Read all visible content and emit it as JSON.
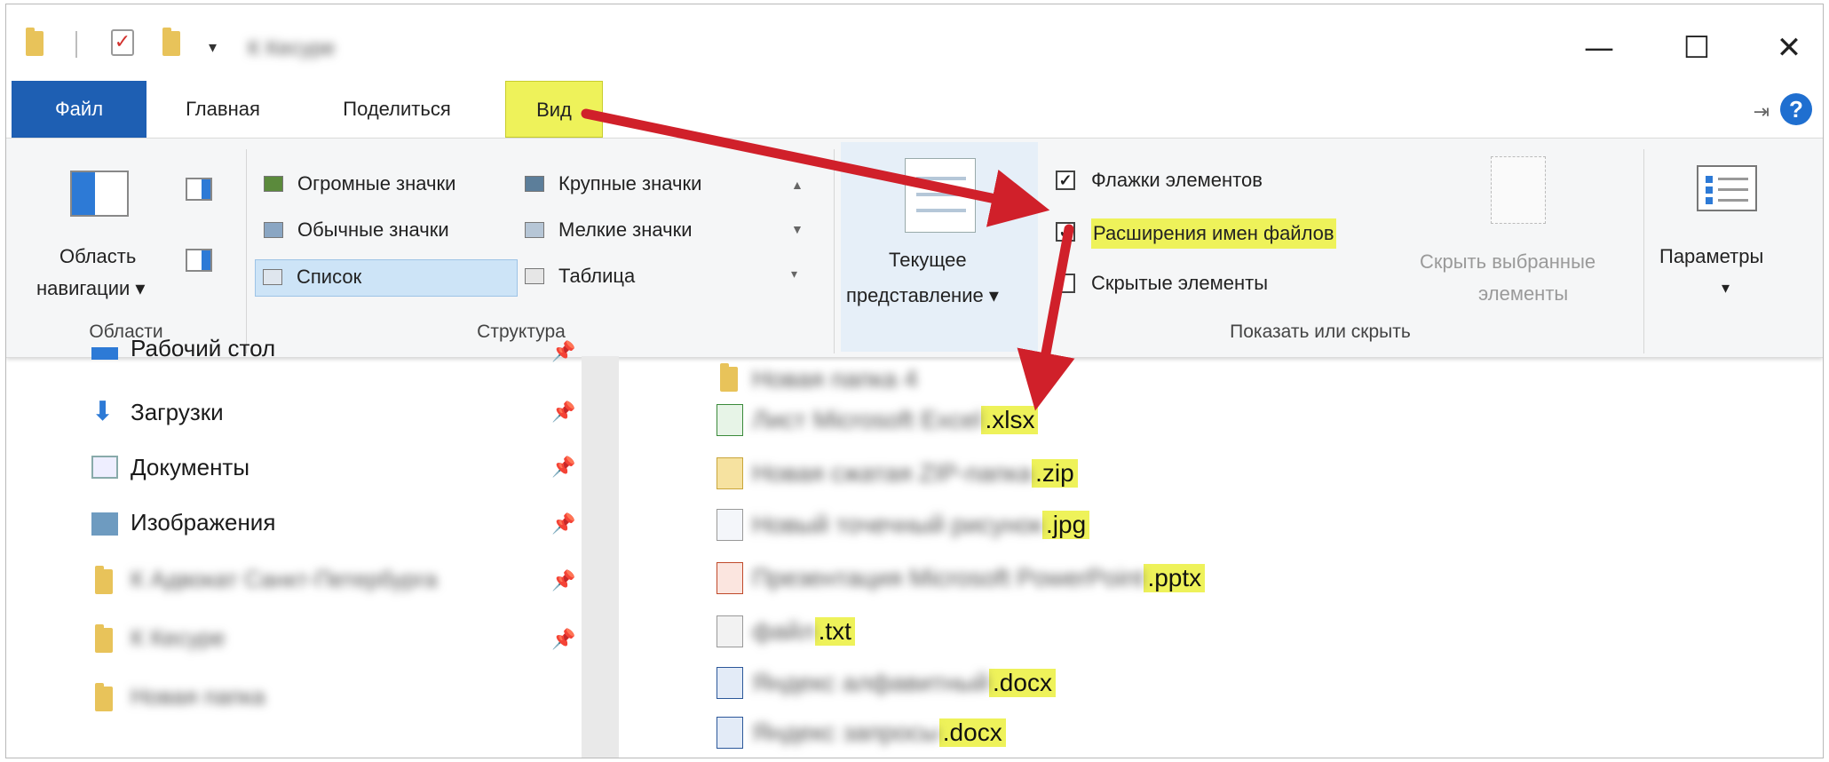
{
  "titlebar": {
    "title": "К Кесуре",
    "controls": {
      "minimize": "—",
      "maximize": "☐",
      "close": "✕"
    },
    "qa_dropdown": "▾"
  },
  "tabs": [
    {
      "label": "Файл"
    },
    {
      "label": "Главная"
    },
    {
      "label": "Поделиться"
    },
    {
      "label": "Вид"
    }
  ],
  "ribbon": {
    "areas": {
      "nav_pane_label_line1": "Область",
      "nav_pane_label_line2": "навигации ▾",
      "group": "Области"
    },
    "structure": {
      "items": [
        {
          "label": "Огромные значки"
        },
        {
          "label": "Крупные значки"
        },
        {
          "label": "Обычные значки"
        },
        {
          "label": "Мелкие значки"
        },
        {
          "label": "Список",
          "selected": true
        },
        {
          "label": "Таблица"
        }
      ],
      "group": "Структура"
    },
    "current_view": {
      "line1": "Текущее",
      "line2": "представление ▾"
    },
    "show_hide": {
      "checkboxes": [
        {
          "label": "Флажки элементов",
          "checked": true
        },
        {
          "label": "Расширения имен файлов",
          "checked": true
        },
        {
          "label": "Скрытые элементы",
          "checked": false
        }
      ],
      "hide_selected_line1": "Скрыть выбранные",
      "hide_selected_line2": "элементы",
      "group": "Показать или скрыть"
    },
    "params": {
      "label": "Параметры",
      "caret": "▾"
    }
  },
  "nav_items": [
    {
      "label": "Рабочий стол",
      "pinned": true,
      "icon": "desktop-icon"
    },
    {
      "label": "Загрузки",
      "pinned": true,
      "icon": "download-icon"
    },
    {
      "label": "Документы",
      "pinned": true,
      "icon": "documents-icon"
    },
    {
      "label": "Изображения",
      "pinned": true,
      "icon": "images-icon"
    },
    {
      "label": "К Адвокат Санкт-Петербурга",
      "pinned": true,
      "icon": "folder-icon",
      "blurred": true
    },
    {
      "label": "К Кесуре",
      "pinned": true,
      "icon": "folder-icon",
      "blurred": true
    },
    {
      "label": "Новая папка",
      "pinned": false,
      "icon": "folder-icon",
      "blurred": true
    }
  ],
  "files": [
    {
      "name": "Новая папка 4",
      "ext": "",
      "icon": "folder-icon"
    },
    {
      "name": "Лист Microsoft Excel",
      "ext": ".xlsx",
      "icon": "excel-icon"
    },
    {
      "name": "Новая сжатая ZIP-папка",
      "ext": ".zip",
      "icon": "zip-icon"
    },
    {
      "name": "Новый точечный рисунок",
      "ext": ".jpg",
      "icon": "image-file-icon"
    },
    {
      "name": "Презентация Microsoft PowerPoint",
      "ext": ".pptx",
      "icon": "powerpoint-icon"
    },
    {
      "name": "файл",
      "ext": ".txt",
      "icon": "text-file-icon"
    },
    {
      "name": "Яндекс алфавитный",
      "ext": ".docx",
      "icon": "word-icon"
    },
    {
      "name": "Яндекс запросы",
      "ext": ".docx",
      "icon": "word-icon"
    }
  ],
  "colors": {
    "accent": "#1e5fb3",
    "highlight": "#eef25a",
    "arrow": "#d0202a"
  }
}
